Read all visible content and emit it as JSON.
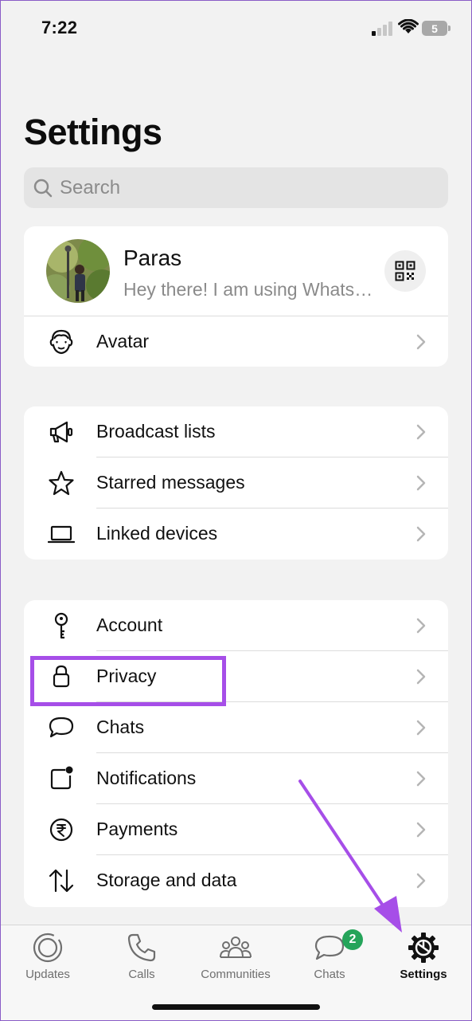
{
  "status_bar": {
    "time": "7:22",
    "battery": "5"
  },
  "header": {
    "title": "Settings"
  },
  "search": {
    "placeholder": "Search"
  },
  "profile": {
    "name": "Paras",
    "status": "Hey there! I am using WhatsApp."
  },
  "avatar_row": {
    "label": "Avatar"
  },
  "group1": [
    {
      "label": "Broadcast lists",
      "icon": "megaphone-icon"
    },
    {
      "label": "Starred messages",
      "icon": "star-icon"
    },
    {
      "label": "Linked devices",
      "icon": "laptop-icon"
    }
  ],
  "group2": [
    {
      "label": "Account",
      "icon": "key-icon"
    },
    {
      "label": "Privacy",
      "icon": "lock-icon"
    },
    {
      "label": "Chats",
      "icon": "chat-bubble-icon"
    },
    {
      "label": "Notifications",
      "icon": "notification-icon"
    },
    {
      "label": "Payments",
      "icon": "rupee-icon"
    },
    {
      "label": "Storage and data",
      "icon": "up-down-arrows-icon"
    }
  ],
  "tabs": [
    {
      "label": "Updates",
      "icon": "updates-icon"
    },
    {
      "label": "Calls",
      "icon": "phone-icon"
    },
    {
      "label": "Communities",
      "icon": "communities-icon"
    },
    {
      "label": "Chats",
      "icon": "chats-icon",
      "badge": "2"
    },
    {
      "label": "Settings",
      "icon": "settings-gear-icon",
      "active": true
    }
  ],
  "colors": {
    "highlight": "#a64ee8",
    "badge": "#25a45a",
    "background": "#f2f2f2"
  }
}
